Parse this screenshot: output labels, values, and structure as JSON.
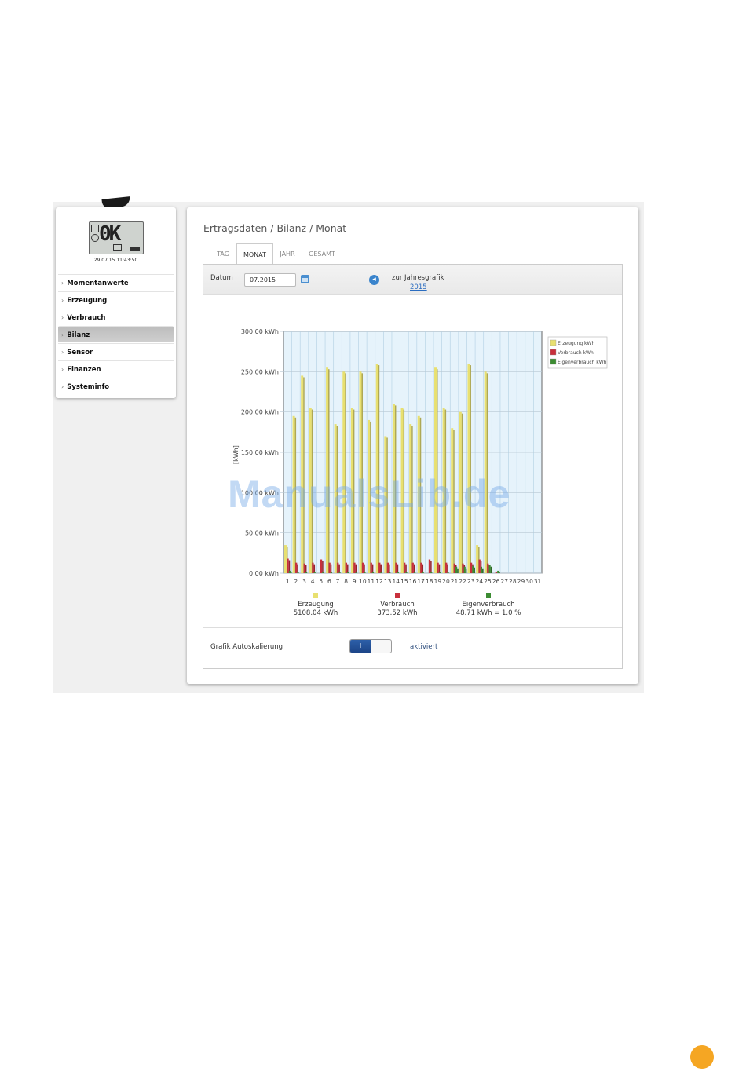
{
  "sidebar": {
    "lcd_text": "0K",
    "lcd_datetime": "29.07.15 11:43:50",
    "items": [
      {
        "label": "Momentanwerte"
      },
      {
        "label": "Erzeugung"
      },
      {
        "label": "Verbrauch"
      },
      {
        "label": "Bilanz",
        "active": true
      },
      {
        "label": "Sensor"
      },
      {
        "label": "Finanzen"
      },
      {
        "label": "Systeminfo"
      }
    ]
  },
  "breadcrumb": "Ertragsdaten / Bilanz / Monat",
  "tabs": [
    {
      "label": "TAG"
    },
    {
      "label": "MONAT",
      "active": true
    },
    {
      "label": "JAHR"
    },
    {
      "label": "GESAMT"
    }
  ],
  "date_bar": {
    "label": "Datum",
    "value": "07.2015",
    "year_link_label": "zur Jahresgrafik",
    "year_link": "2015"
  },
  "chart_data": {
    "type": "bar",
    "ylabel": "[kWh]",
    "ylim": [
      0,
      300
    ],
    "y_ticks": [
      "0.00 kWh",
      "50.00 kWh",
      "100.00 kWh",
      "150.00 kWh",
      "200.00 kWh",
      "250.00 kWh",
      "300.00 kWh"
    ],
    "categories": [
      "1",
      "2",
      "3",
      "4",
      "5",
      "6",
      "7",
      "8",
      "9",
      "10",
      "11",
      "12",
      "13",
      "14",
      "15",
      "16",
      "17",
      "18",
      "19",
      "20",
      "21",
      "22",
      "23",
      "24",
      "25",
      "26",
      "27",
      "28",
      "29",
      "30",
      "31"
    ],
    "series": [
      {
        "name": "Erzeugung kWh",
        "color": "#e8e070",
        "values": [
          35,
          195,
          245,
          205,
          0,
          255,
          185,
          250,
          205,
          250,
          190,
          260,
          170,
          210,
          205,
          185,
          195,
          0,
          255,
          205,
          180,
          200,
          260,
          35,
          250,
          0,
          0,
          0,
          0,
          0,
          0
        ]
      },
      {
        "name": "Verbrauch kWh",
        "color": "#c8303c",
        "values": [
          18,
          13,
          12,
          13,
          17,
          13,
          13,
          13,
          13,
          13,
          13,
          13,
          13,
          13,
          13,
          13,
          13,
          17,
          13,
          13,
          12,
          12,
          13,
          17,
          12,
          2,
          0,
          0,
          0,
          0,
          0
        ]
      },
      {
        "name": "Eigenverbrauch kWh",
        "color": "#3c8c32",
        "values": [
          3,
          1,
          1,
          1,
          1,
          1,
          1,
          1,
          1,
          1,
          1,
          1,
          1,
          1,
          1,
          1,
          1,
          1,
          1,
          1,
          8,
          8,
          9,
          8,
          10,
          3,
          0,
          0,
          0,
          0,
          0
        ]
      }
    ],
    "legend_position": "top-right",
    "grid": true,
    "totals": [
      {
        "name": "Erzeugung",
        "value": "5108.04 kWh",
        "color": "#e8e070"
      },
      {
        "name": "Verbrauch",
        "value": "373.52 kWh",
        "color": "#c8303c"
      },
      {
        "name": "Eigenverbrauch",
        "value": "48.71 kWh = 1.0 %",
        "color": "#3c8c32"
      }
    ]
  },
  "autoscale": {
    "label": "Grafik Autoskalierung",
    "toggle_label": "I",
    "state": "aktiviert"
  },
  "watermark": "ManualsLib.de"
}
